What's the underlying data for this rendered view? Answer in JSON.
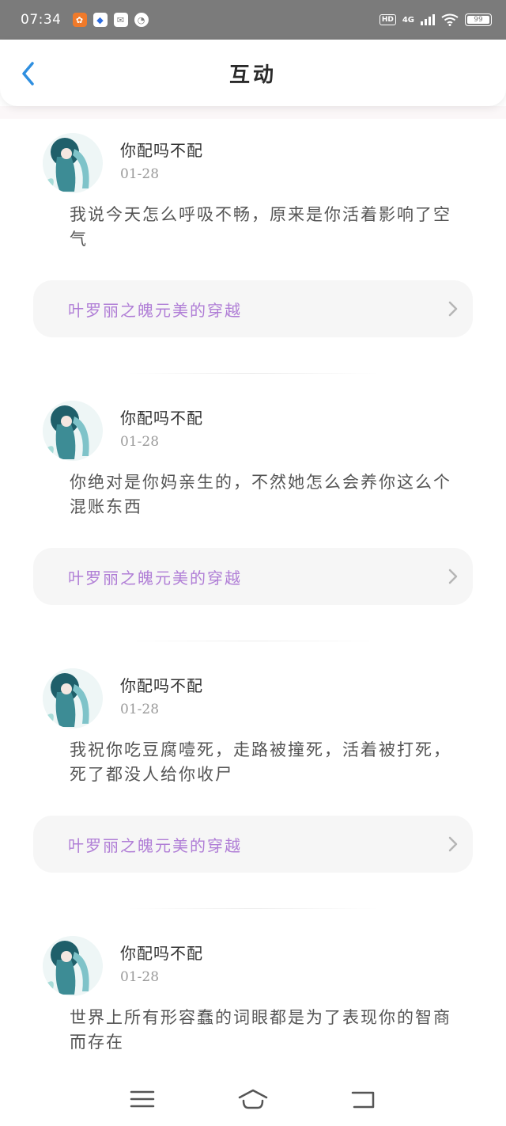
{
  "status_bar": {
    "time": "07:34",
    "network": "4G",
    "hd": "HD",
    "battery": "99"
  },
  "header": {
    "title": "互动"
  },
  "posts": [
    {
      "username": "你配吗不配",
      "date": "01-28",
      "text": "我说今天怎么呼吸不畅，原来是你活着影响了空气",
      "article": "叶罗丽之魄元美的穿越"
    },
    {
      "username": "你配吗不配",
      "date": "01-28",
      "text": "你绝对是你妈亲生的，不然她怎么会养你这么个混账东西",
      "article": "叶罗丽之魄元美的穿越"
    },
    {
      "username": "你配吗不配",
      "date": "01-28",
      "text": "我祝你吃豆腐噎死，走路被撞死，活着被打死，死了都没人给你收尸",
      "article": "叶罗丽之魄元美的穿越"
    },
    {
      "username": "你配吗不配",
      "date": "01-28",
      "text": "世界上所有形容蠢的词眼都是为了表现你的智商而存在",
      "article": ""
    }
  ],
  "colors": {
    "accent_blue": "#2f8fe0",
    "article_purple": "#b07ed6",
    "status_bar": "#7b7b7b"
  },
  "icons": {
    "back": "back-arrow-icon",
    "chevron": "chevron-right-icon",
    "menu": "menu-icon",
    "home": "home-icon",
    "back_nav": "back-nav-icon"
  }
}
